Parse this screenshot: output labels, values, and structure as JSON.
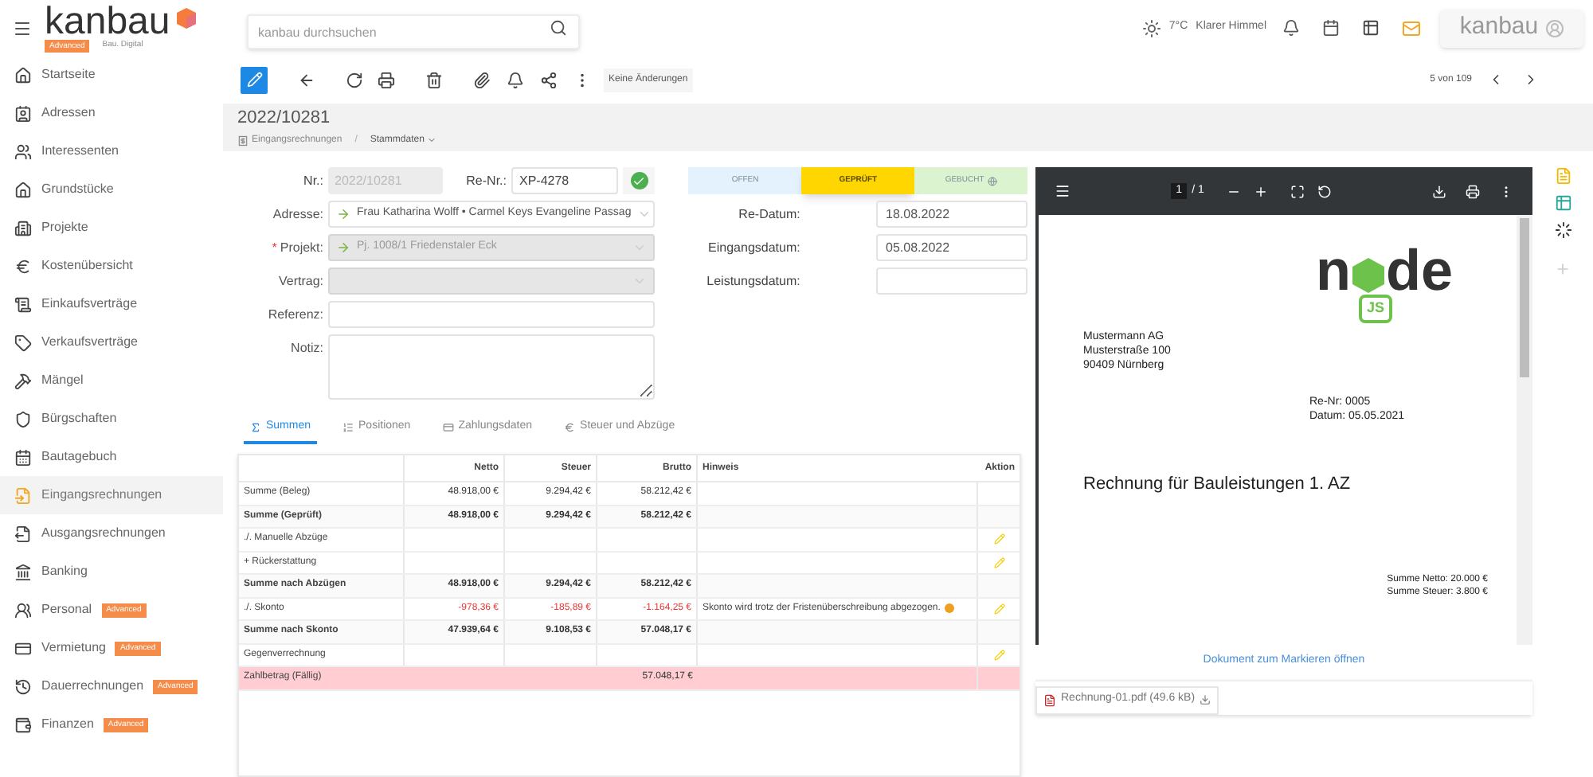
{
  "header": {
    "logo": "kanbau",
    "logo_badge": "Advanced",
    "logo_tagline": "Bau. Digital",
    "search": {
      "placeholder": "kanbau durchsuchen"
    },
    "weather": {
      "temperature": "7°C",
      "condition": "Klarer Himmel"
    },
    "user_button": "kanbau"
  },
  "sidebar": {
    "items": [
      {
        "label": "Startseite",
        "selected": false
      },
      {
        "label": "Adressen",
        "selected": false
      },
      {
        "label": "Interessenten",
        "selected": false
      },
      {
        "label": "Grundstücke",
        "selected": false
      },
      {
        "label": "Projekte",
        "selected": false
      },
      {
        "label": "Kostenübersicht",
        "selected": false
      },
      {
        "label": "Einkaufsverträge",
        "selected": false
      },
      {
        "label": "Verkaufsverträge",
        "selected": false
      },
      {
        "label": "Mängel",
        "selected": false
      },
      {
        "label": "Bürgschaften",
        "selected": false
      },
      {
        "label": "Bautagebuch",
        "selected": false
      },
      {
        "label": "Eingangsrechnungen",
        "selected": true
      },
      {
        "label": "Ausgangsrechnungen",
        "selected": false
      },
      {
        "label": "Banking",
        "selected": false
      },
      {
        "label": "Personal",
        "selected": false,
        "badge": "Advanced"
      },
      {
        "label": "Vermietung",
        "selected": false,
        "badge": "Advanced"
      },
      {
        "label": "Dauerrechnungen",
        "selected": false,
        "badge": "Advanced"
      },
      {
        "label": "Finanzen",
        "selected": false,
        "badge": "Advanced"
      }
    ]
  },
  "toolbar": {
    "status_chip": "Keine Änderungen",
    "pager": "5 von 109"
  },
  "record": {
    "title": "2022/10281",
    "breadcrumb": [
      "Eingangsrechnungen",
      "Stammdaten"
    ],
    "separator": "/"
  },
  "form": {
    "nr": {
      "label": "Nr.:",
      "value": "2022/10281",
      "disabled": true
    },
    "re_nr": {
      "label": "Re-Nr.:",
      "value": "XP-4278",
      "valid": true
    },
    "fields": [
      {
        "label": "Adresse:",
        "kind": "select",
        "value": "Frau Katharina Wolff • Carmel Keys Evangeline Passag",
        "disabled": false
      },
      {
        "label": "Projekt:",
        "marker": "*",
        "kind": "select",
        "value": "Pj. 1008/1 Friedenstaler Eck",
        "disabled": true
      },
      {
        "label": "Vertrag:",
        "kind": "select",
        "disabled": true
      },
      {
        "label": "Referenz:",
        "kind": "text",
        "disabled": false
      },
      {
        "label": "Notiz:",
        "kind": "textarea",
        "disabled": false
      }
    ],
    "status_steps": [
      {
        "label": "OFFEN",
        "color": "#e3f2fd",
        "selected": false
      },
      {
        "label": "GEPRÜFT",
        "color": "#ffd600",
        "selected": true
      },
      {
        "label": "GEBUCHT",
        "color": "#dcf3d0",
        "selected": false
      }
    ],
    "dates": [
      {
        "label": "Re-Datum:",
        "value": "18.08.2022"
      },
      {
        "label": "Eingangsdatum:",
        "value": "05.08.2022"
      },
      {
        "label": "Leistungsdatum:"
      }
    ]
  },
  "tabs": [
    {
      "label": "Summen",
      "selected": true
    },
    {
      "label": "Positionen",
      "selected": false
    },
    {
      "label": "Zahlungsdaten",
      "selected": false
    },
    {
      "label": "Steuer und Abzüge",
      "selected": false
    }
  ],
  "table": {
    "columns": [
      "Netto",
      "Steuer",
      "Brutto",
      "Hinweis",
      "Aktion"
    ],
    "rows": [
      {
        "kind": "plain",
        "label": "Summe (Beleg)",
        "netto": "48.918,00 €",
        "steuer": "9.294,42 €",
        "brutto": "58.212,42 €",
        "editable": false
      },
      {
        "kind": "total",
        "label": "Summe (Geprüft)",
        "netto": "48.918,00 €",
        "steuer": "9.294,42 €",
        "brutto": "58.212,42 €",
        "editable": false
      },
      {
        "kind": "plain",
        "label": "./. Manuelle Abzüge",
        "editable": true
      },
      {
        "kind": "plain",
        "label": "+ Rückerstattung",
        "editable": true
      },
      {
        "kind": "total",
        "label": "Summe nach Abzügen",
        "netto": "48.918,00 €",
        "steuer": "9.294,42 €",
        "brutto": "58.212,42 €",
        "editable": false
      },
      {
        "kind": "deduction",
        "label": "./. Skonto",
        "netto": "-978,36 €",
        "steuer": "-185,89 €",
        "brutto": "-1.164,25 €",
        "hint": "Skonto wird trotz der Fristenüberschreibung abgezogen.",
        "flagged": true,
        "editable": true
      },
      {
        "kind": "total",
        "label": "Summe nach Skonto",
        "netto": "47.939,64 €",
        "steuer": "9.108,53 €",
        "brutto": "57.048,17 €",
        "editable": false
      },
      {
        "kind": "plain",
        "label": "Gegenverrechnung",
        "editable": true
      },
      {
        "kind": "due",
        "label": "Zahlbetrag (Fällig)",
        "brutto": "57.048,17 €",
        "editable": false
      }
    ]
  },
  "viewer": {
    "page": "1",
    "page_total": "/ 1",
    "document": {
      "logo": {
        "left": "n",
        "right": "de",
        "badge": "JS"
      },
      "sender": [
        "Mustermann AG",
        "Musterstraße 100",
        "90409 Nürnberg"
      ],
      "meta": [
        "Re-Nr: 0005",
        "Datum: 05.05.2021"
      ],
      "heading": "Rechnung für Bauleistungen 1. AZ",
      "totals": [
        "Summe Netto: 20.000 €",
        "Summe Steuer: 3.800 €"
      ]
    },
    "open_link": "Dokument zum Markieren öffnen",
    "attachment": "Rechnung-01.pdf (49.6 kB)"
  }
}
